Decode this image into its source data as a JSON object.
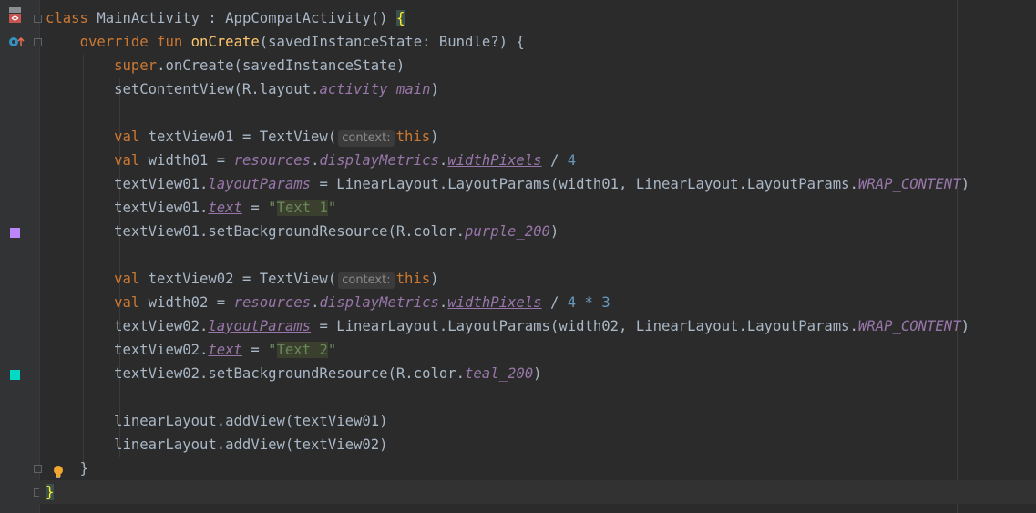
{
  "colors": {
    "purple_200": "#bb86fc",
    "teal_200": "#03dac5",
    "keyword": "#cc7832",
    "function": "#ffc66d",
    "number": "#6897bb",
    "string": "#6a8759",
    "property": "#9876aa",
    "text": "#a9b7c6"
  },
  "gutter_icons": [
    "class-layout-icon",
    "override-method-icon",
    "color-swatch-purple-icon",
    "color-swatch-teal-icon",
    "lightbulb-icon"
  ],
  "code": {
    "l1": {
      "kw": "class",
      "rest": " MainActivity : AppCompatActivity() ",
      "brace": "{"
    },
    "l2": {
      "kw": "override fun",
      "fn": "onCreate",
      "rest": "(savedInstanceState: Bundle?) {"
    },
    "l3": {
      "kw": "super",
      "rest": ".onCreate(savedInstanceState)"
    },
    "l4": {
      "a": "setContentView(R.layout.",
      "prop": "activity_main",
      "b": ")"
    },
    "l6": {
      "kw": "val",
      "a": " textView01 = TextView(",
      "hint": "context:",
      "kw2": "this",
      "b": ")"
    },
    "l7": {
      "kw": "val",
      "a": " width01 = ",
      "p1": "resources",
      "d1": ".",
      "p2": "displayMetrics",
      "d2": ".",
      "p3": "widthPixels",
      "b": " / ",
      "num": "4"
    },
    "l8": {
      "a": "textView01.",
      "p1": "layoutParams",
      "b": " = LinearLayout.LayoutParams(width01, LinearLayout.LayoutParams.",
      "p2": "WRAP_CONTENT",
      "c": ")"
    },
    "l9": {
      "a": "textView01.",
      "p1": "text",
      "b": " = ",
      "q1": "\"",
      "s": "Text 1",
      "q2": "\""
    },
    "l10": {
      "a": "textView01.setBackgroundResource(R.color.",
      "prop": "purple_200",
      "b": ")"
    },
    "l12": {
      "kw": "val",
      "a": " textView02 = TextView(",
      "hint": "context:",
      "kw2": "this",
      "b": ")"
    },
    "l13": {
      "kw": "val",
      "a": " width02 = ",
      "p1": "resources",
      "d1": ".",
      "p2": "displayMetrics",
      "d2": ".",
      "p3": "widthPixels",
      "b": " / ",
      "num": "4 * 3"
    },
    "l14": {
      "a": "textView02.",
      "p1": "layoutParams",
      "b": " = LinearLayout.LayoutParams(width02, LinearLayout.LayoutParams.",
      "p2": "WRAP_CONTENT",
      "c": ")"
    },
    "l15": {
      "a": "textView02.",
      "p1": "text",
      "b": " = ",
      "q1": "\"",
      "s": "Text 2",
      "q2": "\""
    },
    "l16": {
      "a": "textView02.setBackgroundResource(R.color.",
      "prop": "teal_200",
      "b": ")"
    },
    "l18": {
      "a": "linearLayout.addView(textView01)"
    },
    "l19": {
      "a": "linearLayout.addView(textView02)"
    },
    "l20": {
      "a": "}"
    },
    "l21": {
      "brace": "}"
    }
  }
}
